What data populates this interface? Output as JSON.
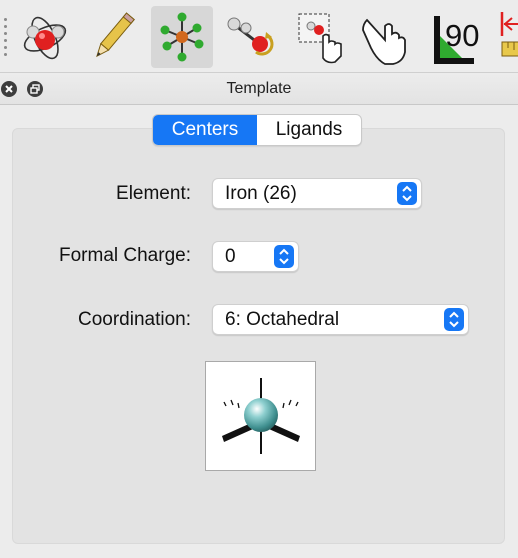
{
  "toolbar": {
    "tools": [
      {
        "name": "atom-orbit-icon",
        "selected": false
      },
      {
        "name": "pencil-icon",
        "selected": false
      },
      {
        "name": "molecule-template-icon",
        "selected": true
      },
      {
        "name": "bond-rotate-icon",
        "selected": false
      },
      {
        "name": "select-drag-icon",
        "selected": false
      },
      {
        "name": "hand-pointer-icon",
        "selected": false
      },
      {
        "name": "angle-measure-icon",
        "selected": false
      },
      {
        "name": "ruler-measure-icon",
        "selected": false
      }
    ],
    "angle_value": "90"
  },
  "panel": {
    "title": "Template"
  },
  "tabs": {
    "centers": "Centers",
    "ligands": "Ligands",
    "active": "centers"
  },
  "form": {
    "element_label": "Element:",
    "element_value": "Iron (26)",
    "charge_label": "Formal Charge:",
    "charge_value": "0",
    "coordination_label": "Coordination:",
    "coordination_value": "6: Octahedral"
  },
  "colors": {
    "accent": "#1677f5",
    "atom_teal": "#4fa3a3",
    "oxygen_red": "#e02020"
  }
}
